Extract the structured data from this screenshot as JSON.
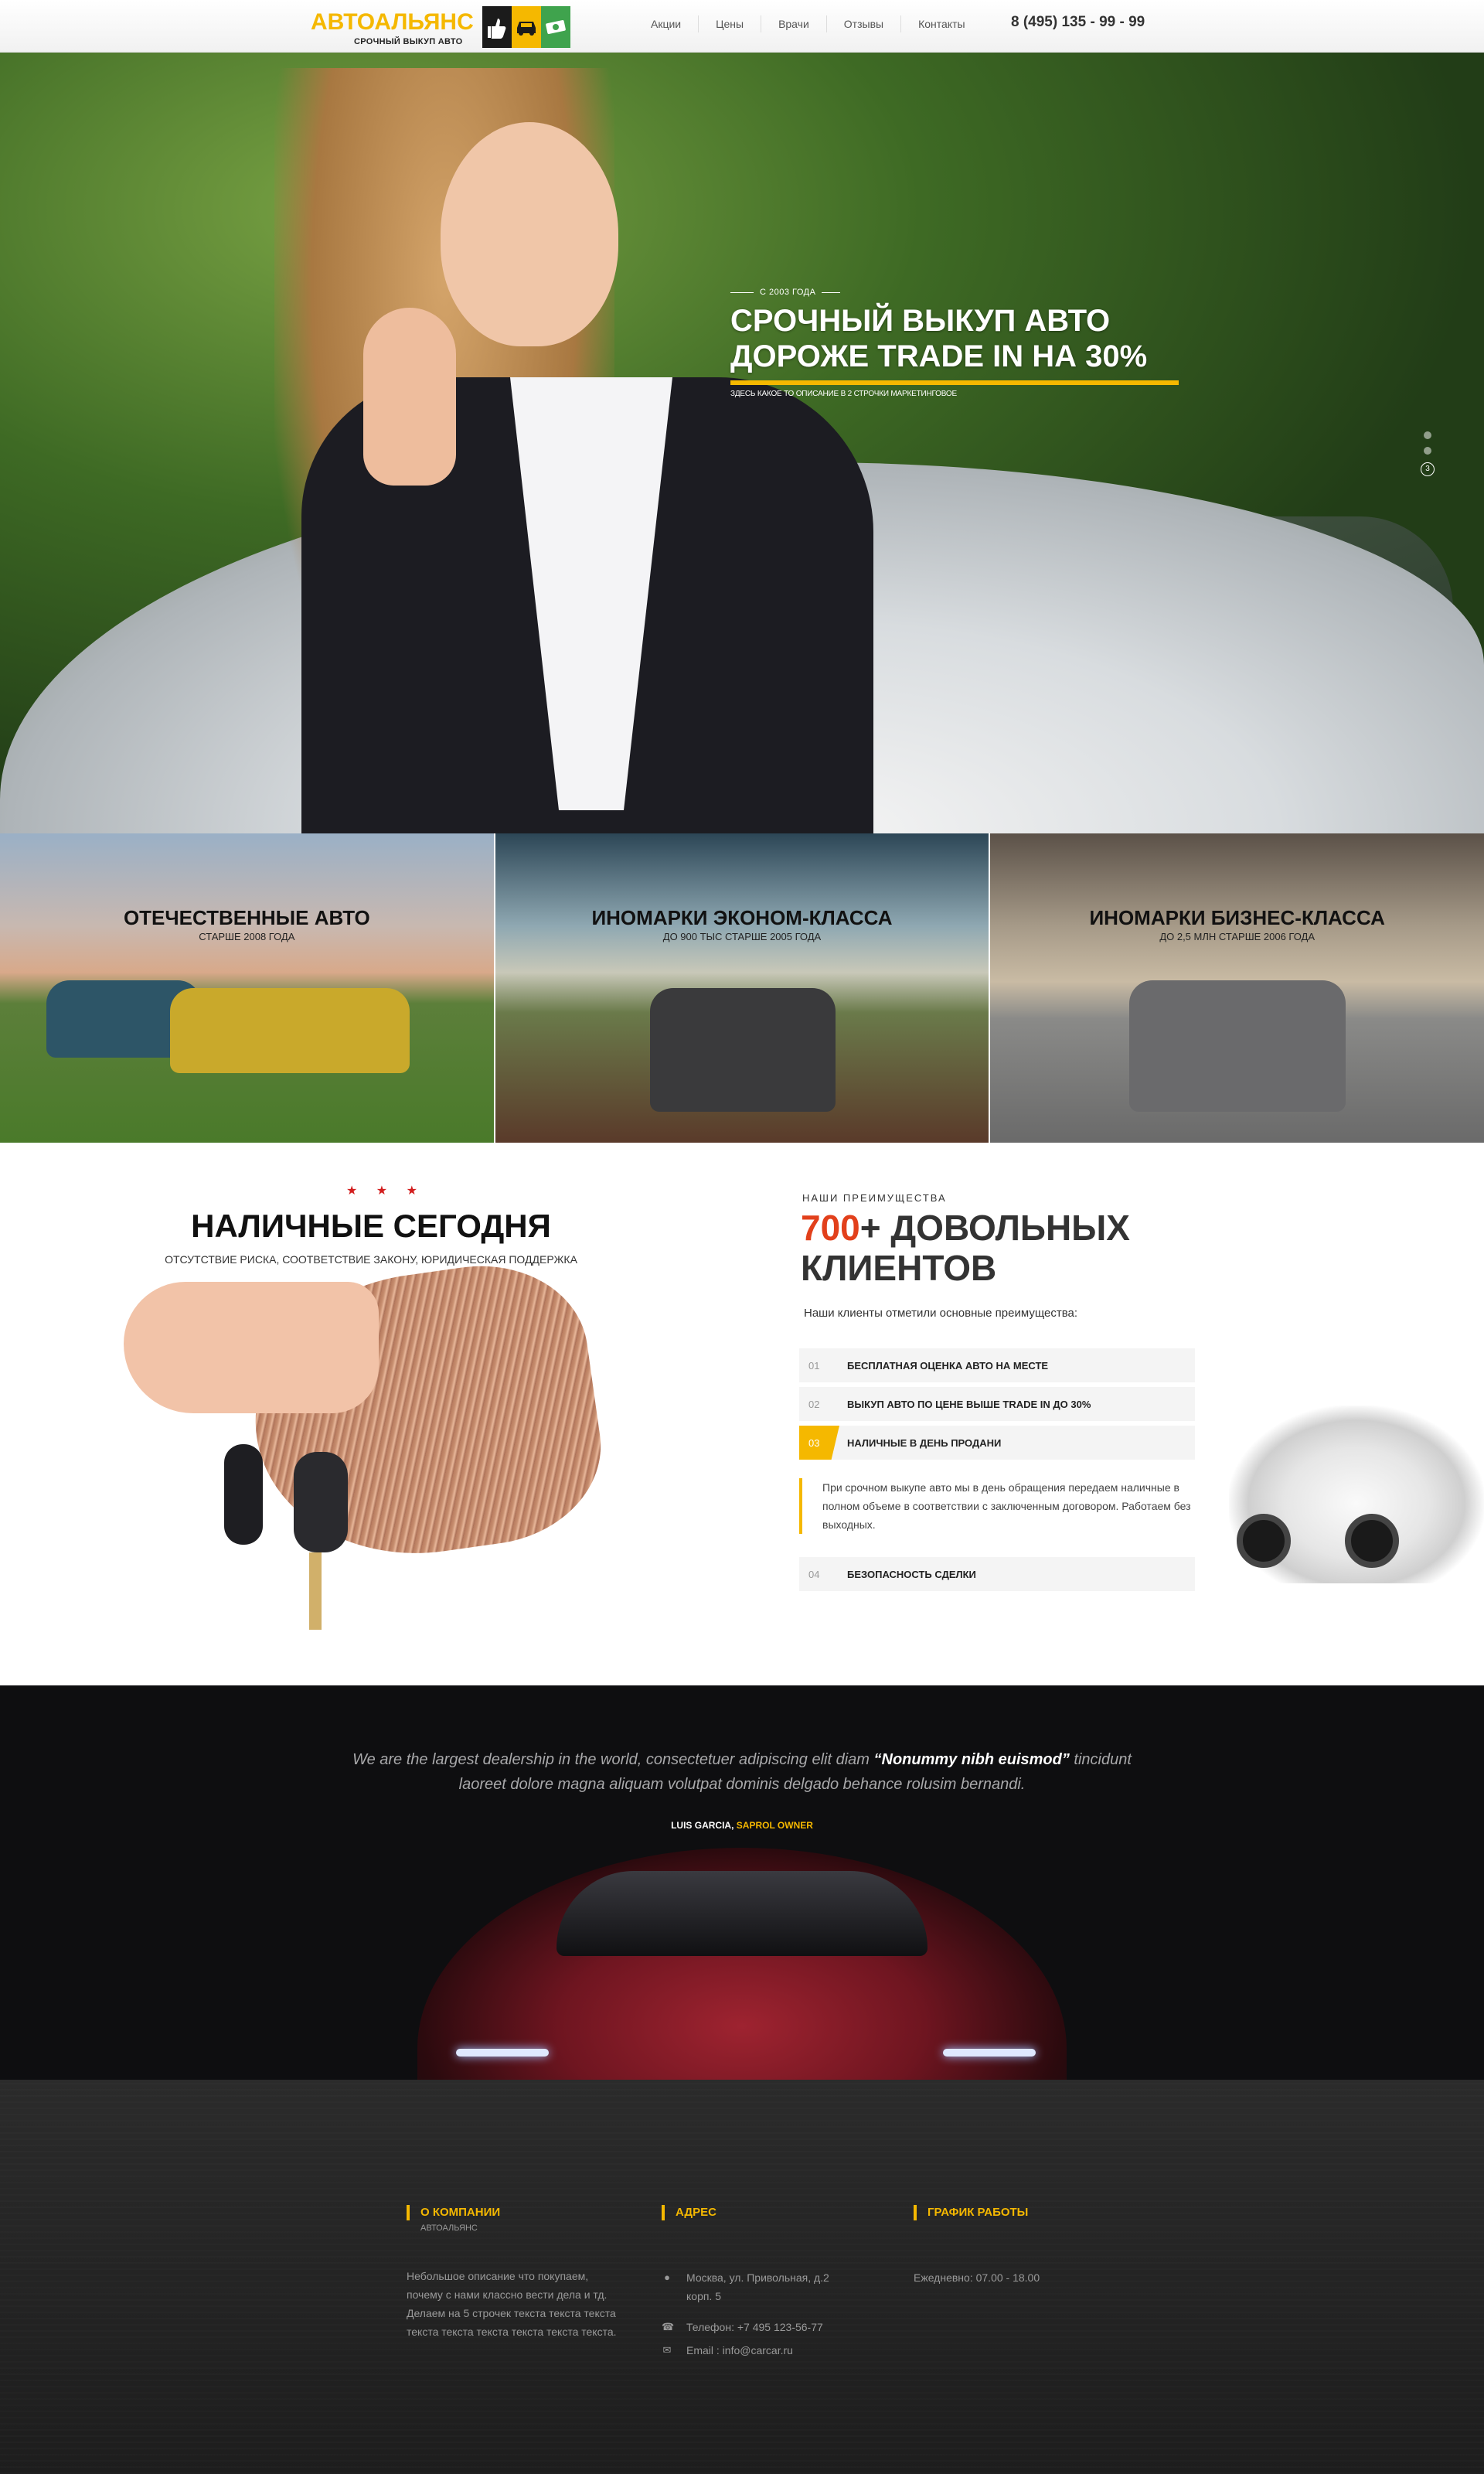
{
  "header": {
    "logo_title": "АВТОАЛЬЯНС",
    "logo_sub": "СРОЧНЫЙ ВЫКУП АВТО",
    "nav": [
      "Акции",
      "Цены",
      "Врачи",
      "Отзывы",
      "Контакты"
    ],
    "phone": "8 (495) 135 - 99 - 99"
  },
  "hero": {
    "since": "С 2003 ГОДА",
    "title_line1": "СРОЧНЫЙ ВЫКУП АВТО",
    "title_line2": "ДОРОЖЕ TRADE IN НА 30%",
    "desc": "ЗДЕСЬ КАКОЕ ТО ОПИСАНИЕ В 2 СТРОЧКИ МАРКЕТИНГОВОЕ",
    "slide_number": "3",
    "accent": "#f5b800"
  },
  "categories": [
    {
      "title": "ОТЕЧЕСТВЕННЫЕ АВТО",
      "sub": "СТАРШЕ 2008 ГОДА"
    },
    {
      "title": "ИНОМАРКИ ЭКОНОМ-КЛАССА",
      "sub": "ДО 900 ТЫС СТАРШЕ 2005 ГОДА"
    },
    {
      "title": "ИНОМАРКИ БИЗНЕС-КЛАССА",
      "sub": "ДО 2,5 МЛН СТАРШЕ 2006 ГОДА"
    }
  ],
  "cash": {
    "stars": "★ ★ ★",
    "title": "НАЛИЧНЫЕ СЕГОДНЯ",
    "sub": "ОТСУТСТВИЕ РИСКА, СООТВЕТСТВИЕ ЗАКОНУ, ЮРИДИЧЕСКАЯ ПОДДЕРЖКА"
  },
  "advantages": {
    "kicker": "НАШИ ПРЕИМУЩЕСТВА",
    "count": "700",
    "title_rest_1": "+ ДОВОЛЬНЫХ",
    "title_rest_2": "КЛИЕНТОВ",
    "lead": "Наши клиенты отметили основные преимущества:",
    "items": [
      {
        "num": "01",
        "label": "БЕСПЛАТНАЯ ОЦЕНКА АВТО НА МЕСТЕ"
      },
      {
        "num": "02",
        "label": "ВЫКУП АВТО ПО ЦЕНЕ ВЫШЕ TRADE IN ДО 30%"
      },
      {
        "num": "03",
        "label": "НАЛИЧНЫЕ В ДЕНЬ ПРОДАНИ"
      },
      {
        "num": "04",
        "label": "БЕЗОПАСНОСТЬ СДЕЛКИ"
      }
    ],
    "active_body": "При срочном выкупе авто мы в день обращения передаем наличные в полном объеме в соответствии с заключенным договором. Работаем без выходных."
  },
  "testimonial": {
    "quote_part1": "We are the largest dealership in the world, consectetuer adipiscing elit diam ",
    "quote_bold": "“Nonummy nibh euismod”",
    "quote_part2": " tincidunt laoreet dolore magna aliquam volutpat dominis delgado behance rolusim bernandi.",
    "author_name": "LUIS GARCIA,",
    "author_role": "SAPROL OWNER"
  },
  "footer": {
    "about_head": "О КОМПАНИИ",
    "about_sub": "АВТОАЛЬЯНС",
    "about_text": "Небольшое описание что покупаем, почему с нами классно вести дела и тд. Делаем на 5 строчек текста текста текста текста текста текста текста текста текста.",
    "address_head": "АДРЕС",
    "address": "Москва, ул. Привольная, д.2 корп. 5",
    "phone": "Телефон: +7 495 123-56-77",
    "email": "Email : info@carcar.ru",
    "hours_head": "ГРАФИК РАБОТЫ",
    "hours": "Ежедневно: 07.00 - 18.00"
  }
}
